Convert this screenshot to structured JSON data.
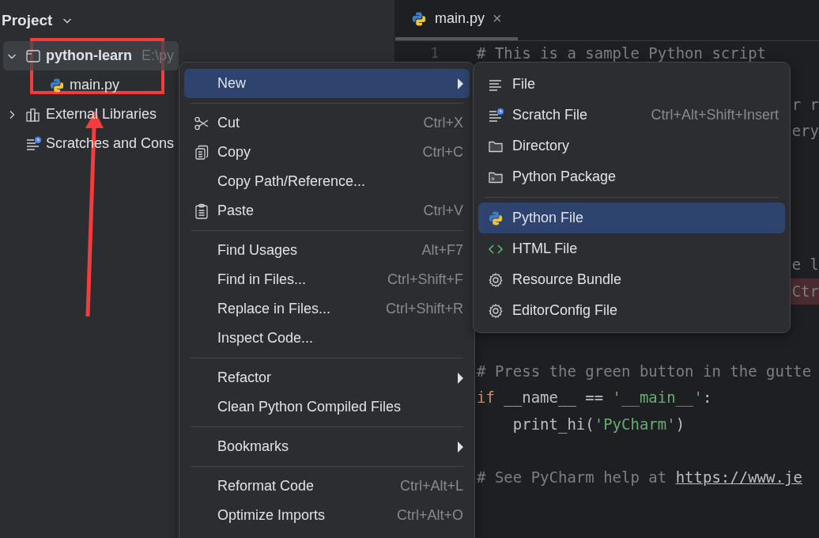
{
  "project_panel": {
    "title": "Project",
    "tree": [
      {
        "label": "python-learn",
        "hint": "E:\\py",
        "kind": "project",
        "expanded": true,
        "selected": true,
        "children": [
          {
            "label": "main.py",
            "kind": "python-file",
            "selected": false
          }
        ]
      },
      {
        "label": "External Libraries",
        "kind": "libraries",
        "expanded": false,
        "selected": false
      },
      {
        "label": "Scratches and Cons",
        "kind": "scratches",
        "selected": false
      }
    ]
  },
  "editor": {
    "tabs": [
      {
        "label": "main.py",
        "close": "×",
        "selected": true
      }
    ],
    "line_numbers": [
      "1"
    ],
    "lines": [
      {
        "kind": "full",
        "breakpoint": false,
        "tokens": [
          {
            "text": "# This is a sample Python script",
            "kind": "comment"
          }
        ]
      },
      {
        "kind": "blank",
        "breakpoint": false
      },
      {
        "kind": "fragment",
        "breakpoint": false,
        "tokens": [
          {
            "text": "r r",
            "kind": "comment"
          }
        ]
      },
      {
        "kind": "fragment",
        "breakpoint": false,
        "tokens": [
          {
            "text": "ery",
            "kind": "comment"
          }
        ]
      },
      {
        "kind": "blank",
        "breakpoint": false
      },
      {
        "kind": "blank",
        "breakpoint": false
      },
      {
        "kind": "blank",
        "breakpoint": false
      },
      {
        "kind": "blank",
        "breakpoint": false
      },
      {
        "kind": "fragment",
        "breakpoint": false,
        "tokens": [
          {
            "text": "e l",
            "kind": "comment"
          }
        ]
      },
      {
        "kind": "fragment",
        "breakpoint": true,
        "tokens": [
          {
            "text": "Ctr",
            "kind": "comment"
          }
        ]
      },
      {
        "kind": "blank",
        "breakpoint": false
      },
      {
        "kind": "blank",
        "breakpoint": false
      },
      {
        "kind": "full",
        "breakpoint": false,
        "tokens": [
          {
            "text": "# Press the green button in the gutte",
            "kind": "comment"
          }
        ]
      },
      {
        "kind": "full",
        "breakpoint": false,
        "tokens": [
          {
            "text": "if",
            "kind": "keyword"
          },
          {
            "text": " __name__ == ",
            "kind": "plain"
          },
          {
            "text": "'__main__'",
            "kind": "string"
          },
          {
            "text": ":",
            "kind": "plain"
          }
        ]
      },
      {
        "kind": "full",
        "breakpoint": false,
        "tokens": [
          {
            "text": "    print_hi(",
            "kind": "plain"
          },
          {
            "text": "'PyCharm'",
            "kind": "string"
          },
          {
            "text": ")",
            "kind": "plain"
          }
        ]
      },
      {
        "kind": "blank",
        "breakpoint": false
      },
      {
        "kind": "full",
        "breakpoint": false,
        "tokens": [
          {
            "text": "# See PyCharm help at ",
            "kind": "comment"
          },
          {
            "text": "https://www.je",
            "kind": "link"
          }
        ]
      }
    ]
  },
  "context_menu": {
    "items": [
      {
        "kind": "item",
        "label": "New",
        "has_submenu": true,
        "selected": true
      },
      {
        "kind": "separator"
      },
      {
        "kind": "item",
        "label": "Cut",
        "shortcut": "Ctrl+X",
        "has_submenu": false,
        "selected": false
      },
      {
        "kind": "item",
        "label": "Copy",
        "shortcut": "Ctrl+C",
        "has_submenu": false,
        "selected": false
      },
      {
        "kind": "item",
        "label": "Copy Path/Reference...",
        "has_submenu": false,
        "selected": false
      },
      {
        "kind": "item",
        "label": "Paste",
        "shortcut": "Ctrl+V",
        "has_submenu": false,
        "selected": false
      },
      {
        "kind": "separator"
      },
      {
        "kind": "item",
        "label": "Find Usages",
        "shortcut": "Alt+F7",
        "has_submenu": false,
        "selected": false
      },
      {
        "kind": "item",
        "label": "Find in Files...",
        "shortcut": "Ctrl+Shift+F",
        "has_submenu": false,
        "selected": false
      },
      {
        "kind": "item",
        "label": "Replace in Files...",
        "shortcut": "Ctrl+Shift+R",
        "has_submenu": false,
        "selected": false
      },
      {
        "kind": "item",
        "label": "Inspect Code...",
        "has_submenu": false,
        "selected": false
      },
      {
        "kind": "separator"
      },
      {
        "kind": "item",
        "label": "Refactor",
        "has_submenu": true,
        "selected": false
      },
      {
        "kind": "item",
        "label": "Clean Python Compiled Files",
        "has_submenu": false,
        "selected": false
      },
      {
        "kind": "separator"
      },
      {
        "kind": "item",
        "label": "Bookmarks",
        "has_submenu": true,
        "selected": false
      },
      {
        "kind": "separator"
      },
      {
        "kind": "item",
        "label": "Reformat Code",
        "shortcut": "Ctrl+Alt+L",
        "has_submenu": false,
        "selected": false
      },
      {
        "kind": "item",
        "label": "Optimize Imports",
        "shortcut": "Ctrl+Alt+O",
        "has_submenu": false,
        "selected": false
      }
    ]
  },
  "new_submenu": {
    "items": [
      {
        "kind": "item",
        "label": "File",
        "selected": false
      },
      {
        "kind": "item",
        "label": "Scratch File",
        "shortcut": "Ctrl+Alt+Shift+Insert",
        "selected": false
      },
      {
        "kind": "item",
        "label": "Directory",
        "selected": false
      },
      {
        "kind": "item",
        "label": "Python Package",
        "selected": false
      },
      {
        "kind": "separator"
      },
      {
        "kind": "item",
        "label": "Python File",
        "selected": true
      },
      {
        "kind": "item",
        "label": "HTML File",
        "selected": false
      },
      {
        "kind": "item",
        "label": "Resource Bundle",
        "selected": false
      },
      {
        "kind": "item",
        "label": "EditorConfig File",
        "selected": false
      }
    ]
  }
}
